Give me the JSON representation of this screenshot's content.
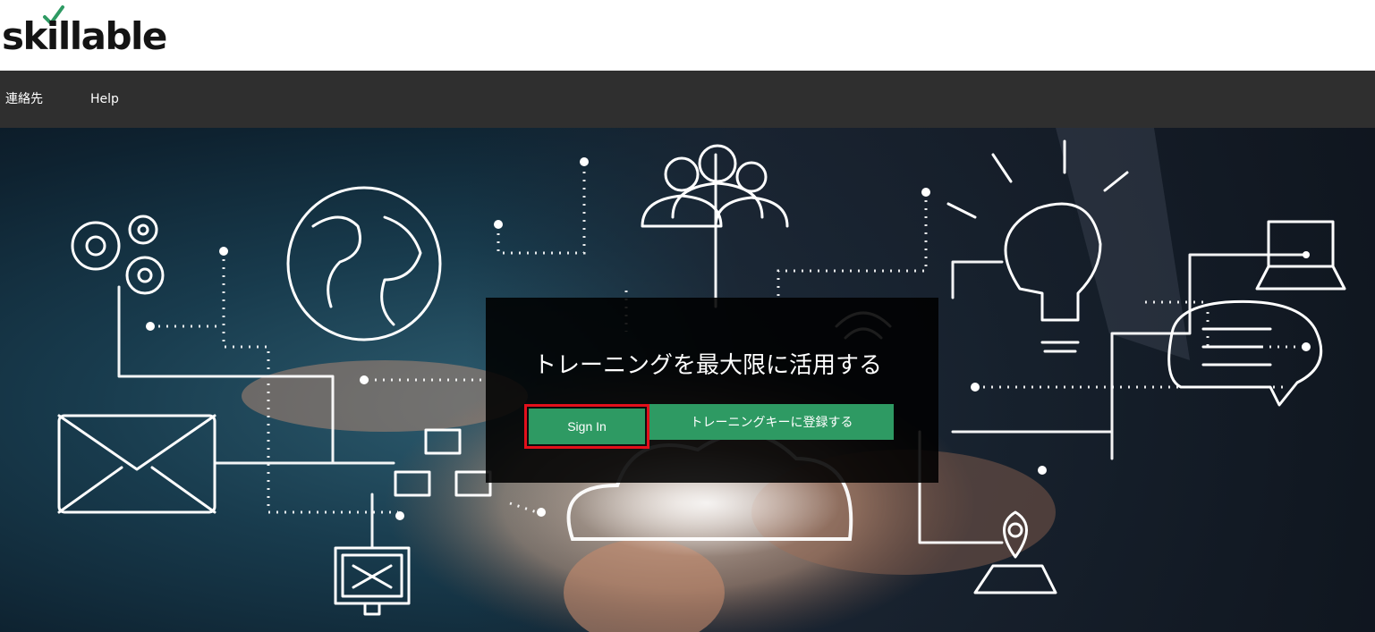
{
  "brand": {
    "logo_text": "skillable",
    "accent_color": "#2e9a63"
  },
  "nav": {
    "items": [
      {
        "label": "連絡先"
      },
      {
        "label": "Help"
      }
    ]
  },
  "hero": {
    "title": "トレーニングを最大限に活用する",
    "buttons": {
      "sign_in": "Sign In",
      "register": "トレーニングキーに登録する"
    },
    "highlight_color": "#e3101b"
  }
}
